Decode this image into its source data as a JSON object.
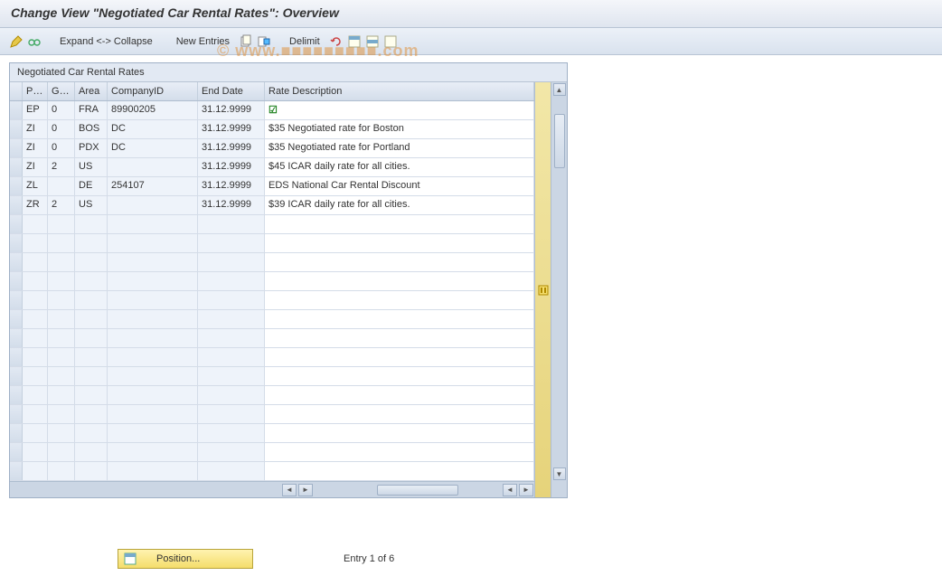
{
  "window": {
    "title": "Change View \"Negotiated Car Rental Rates\": Overview"
  },
  "toolbar": {
    "expand_collapse_label": "Expand <-> Collapse",
    "new_entries_label": "New Entries",
    "delimit_label": "Delimit",
    "icons": {
      "pencil": "pencil-icon",
      "glasses": "glasses-icon",
      "copy": "copy-icon",
      "delete": "delete-icon",
      "undo": "undo-icon",
      "select_all": "select-all-icon",
      "select_block": "select-block-icon",
      "deselect_all": "deselect-all-icon"
    }
  },
  "panel": {
    "title": "Negotiated Car Rental Rates"
  },
  "table": {
    "columns": {
      "pr": "Pr...",
      "ge": "Ge...",
      "area": "Area",
      "company": "CompanyID",
      "end": "End Date",
      "desc": "Rate Description"
    },
    "rows": [
      {
        "pr": "EP",
        "ge": "0",
        "area": "FRA",
        "company": "89900205",
        "end": "31.12.9999",
        "desc": "",
        "check": true
      },
      {
        "pr": "ZI",
        "ge": "0",
        "area": "BOS",
        "company": "DC",
        "end": "31.12.9999",
        "desc": "$35 Negotiated rate for Boston"
      },
      {
        "pr": "ZI",
        "ge": "0",
        "area": "PDX",
        "company": "DC",
        "end": "31.12.9999",
        "desc": "$35 Negotiated rate for Portland"
      },
      {
        "pr": "ZI",
        "ge": "2",
        "area": "US",
        "company": "",
        "end": "31.12.9999",
        "desc": "$45 ICAR daily rate for all cities."
      },
      {
        "pr": "ZL",
        "ge": "",
        "area": "DE",
        "company": "254107",
        "end": "31.12.9999",
        "desc": "EDS National Car Rental Discount"
      },
      {
        "pr": "ZR",
        "ge": "2",
        "area": "US",
        "company": "",
        "end": "31.12.9999",
        "desc": "$39 ICAR daily rate for all cities."
      }
    ],
    "empty_rows": 14
  },
  "footer": {
    "position_button": "Position...",
    "entry_text": "Entry 1 of 6"
  }
}
